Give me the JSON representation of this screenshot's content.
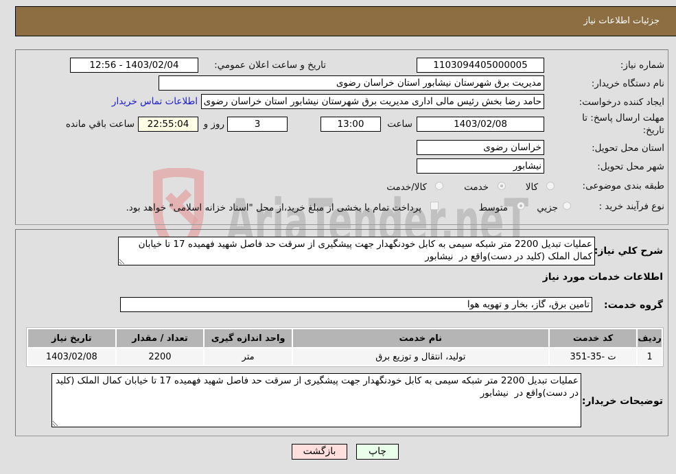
{
  "header": {
    "title": "جزئیات اطلاعات نیاز"
  },
  "form": {
    "need_number": {
      "label": "شماره نیاز:",
      "value": "1103094405000005"
    },
    "announce": {
      "label": "تاريخ و ساعت اعلان عمومي:",
      "value": "1403/02/04 - 12:56"
    },
    "buyer_org": {
      "label": "نام دستگاه خريدار:",
      "value": "مدیریت برق شهرستان نیشابور استان خراسان رضوی"
    },
    "requester": {
      "label": "ايجاد كننده درخواست:",
      "value": "حامد رضا بخش رئیس مالی اداری مدیریت برق شهرستان نیشابور استان خراسان رضوی",
      "contact_link": "اطلاعات تماس خريدار"
    },
    "deadline": {
      "label_line1": "مهلت ارسال پاسخ: تا",
      "label_line2": "تاريخ:",
      "date": "1403/02/08",
      "time_label": "ساعت",
      "time": "13:00",
      "days": "3",
      "days_label": "روز و",
      "remaining": "22:55:04",
      "remaining_label": "ساعت باقي مانده"
    },
    "province": {
      "label": "استان محل تحويل:",
      "value": "خراسان رضوی"
    },
    "city": {
      "label": "شهر محل تحويل:",
      "value": "نیشابور"
    },
    "category": {
      "label": "طبقه بندی موضوعی:",
      "options": [
        "كالا",
        "خدمت",
        "كالا/خدمت"
      ],
      "selected": "خدمت"
    },
    "purchase_type": {
      "label": "نوع فرآيند خريد :",
      "options": [
        "جزيي",
        "متوسط"
      ],
      "selected": "متوسط",
      "treasury_note": "پرداخت تمام يا بخشی از مبلغ خريد،از محل \"اسناد خزانه اسلامی\" خواهد بود."
    }
  },
  "description": {
    "label": "شرح كلي نياز:",
    "value": "عملیات تبدیل 2200 متر شبکه سیمی به کابل خودنگهدار جهت پیشگیری از سرقت حد فاصل شهید فهمیده 17 تا خیابان کمال الملک (کلید در دست)واقع در  نیشابور"
  },
  "services": {
    "section_title": "اطلاعات خدمات مورد نياز",
    "group_label": "گروه خدمت:",
    "group_value": "تامین برق، گاز، بخار و تهویه هوا",
    "columns": [
      "رديف",
      "كد خدمت",
      "نام خدمت",
      "واحد اندازه گيری",
      "تعداد / مقدار",
      "تاريخ نياز"
    ],
    "rows": [
      [
        "1",
        "ت -35-351",
        "تولید، انتقال و توزیع برق",
        "متر",
        "2200",
        "1403/02/08"
      ]
    ]
  },
  "buyer_notes": {
    "label": "توضيحات خريدار:",
    "value": "عملیات تبدیل 2200 متر شبکه سیمی به کابل خودنگهدار جهت پیشگیری از سرقت حد فاصل شهید فهمیده 17 تا خیابان کمال الملک (کلید در دست)واقع در  نیشابور"
  },
  "buttons": {
    "print": "چاپ",
    "back": "بازگشت"
  },
  "watermark": {
    "text": "AriaTender.neT"
  },
  "colors": {
    "header_bg": "#8d6e43",
    "print_bg": "#eaffea",
    "back_bg": "#ffdede",
    "link": "#1a1acc"
  }
}
